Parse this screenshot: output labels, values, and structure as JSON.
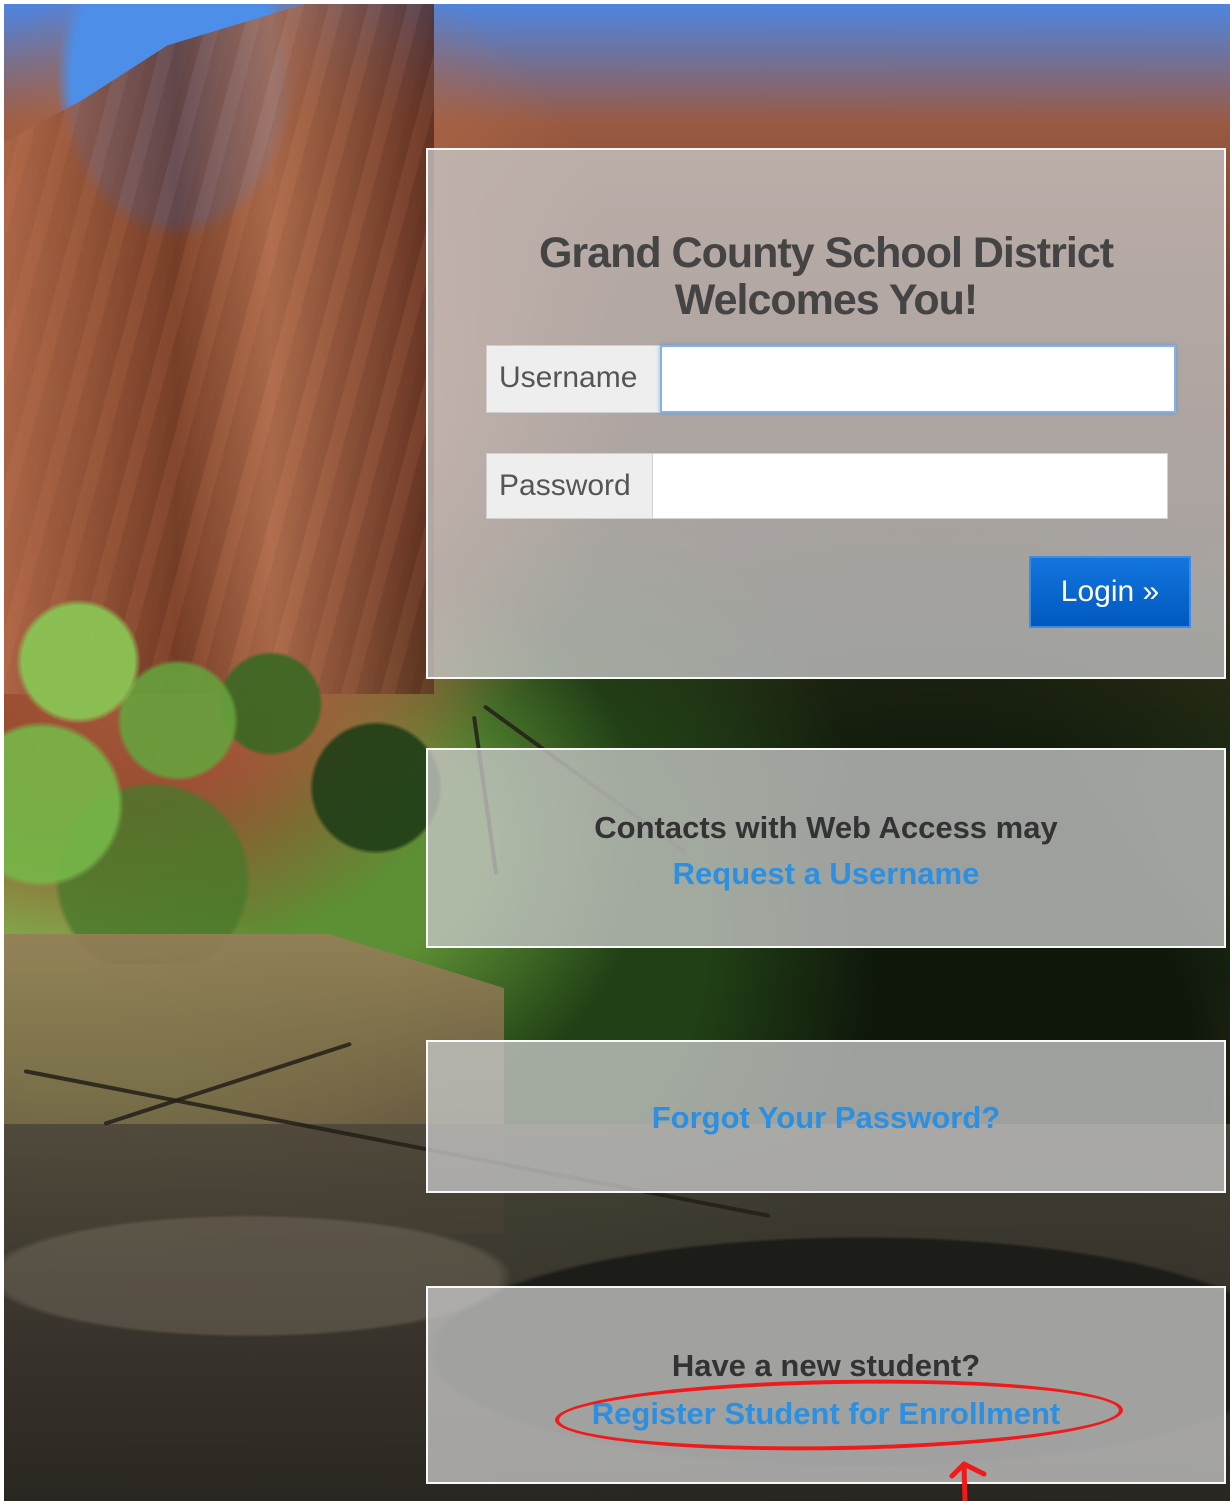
{
  "background": {
    "type": "photo"
  },
  "login": {
    "title_line_1": "Grand County School District",
    "title_line_2": "Welcomes You!",
    "username_label": "Username",
    "username_value": "",
    "password_label": "Password",
    "password_value": "",
    "button_label": "Login »"
  },
  "contacts": {
    "text": "Contacts with Web Access may",
    "link": "Request a Username"
  },
  "password_help": {
    "link": "Forgot Your Password?"
  },
  "enrollment": {
    "text": "Have a new student?",
    "link": "Register Student for Enrollment"
  },
  "annotation": {
    "highlight_color": "#ef1b1b",
    "arrow_icon": "red-arrow-icon"
  }
}
